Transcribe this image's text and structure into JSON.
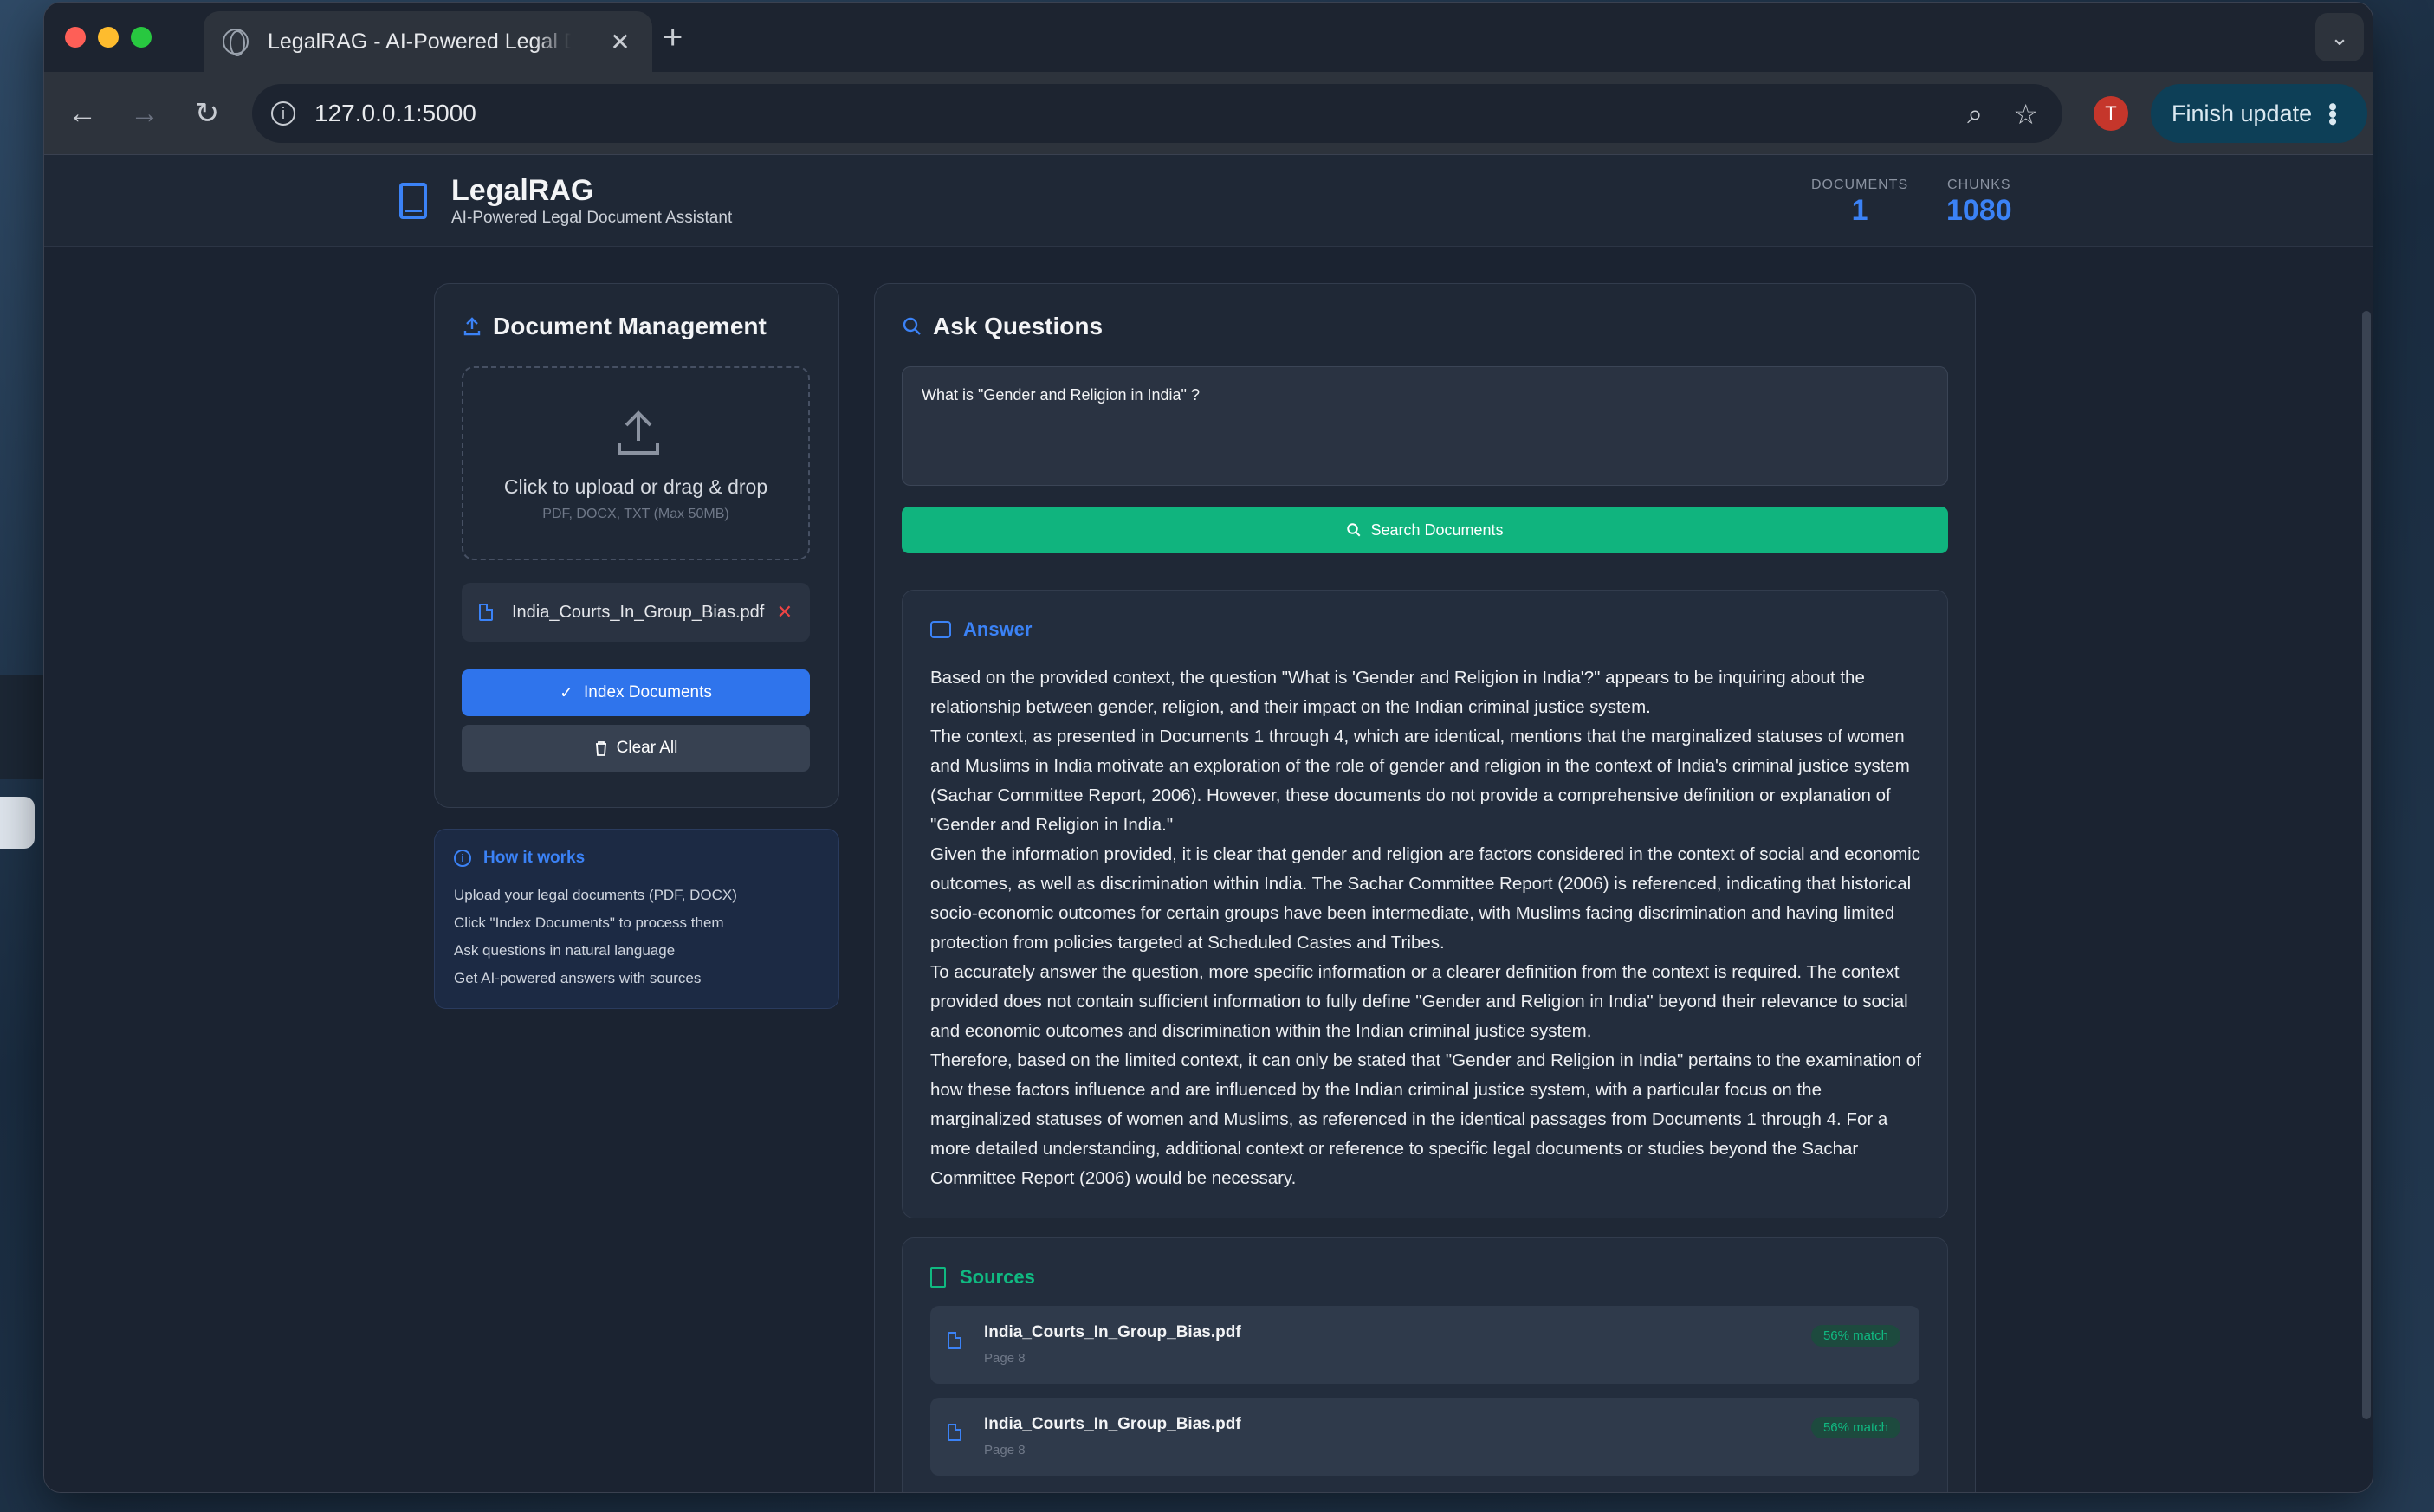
{
  "browser": {
    "tab_title": "LegalRAG - AI-Powered Legal Document Assistant",
    "url": "127.0.0.1:5000",
    "avatar_initial": "T",
    "finish_update": "Finish update"
  },
  "app": {
    "name": "LegalRAG",
    "tagline": "AI-Powered Legal Document Assistant",
    "stats": {
      "documents_label": "DOCUMENTS",
      "documents_value": "1",
      "chunks_label": "CHUNKS",
      "chunks_value": "1080"
    }
  },
  "doc_mgmt": {
    "title": "Document Management",
    "upload_text": "Click to upload or drag & drop",
    "upload_hint": "PDF, DOCX, TXT (Max 50MB)",
    "file_name": "India_Courts_In_Group_Bias.pdf",
    "index_button": "Index Documents",
    "clear_button": "Clear All"
  },
  "how_it_works": {
    "title": "How it works",
    "steps": [
      "Upload your legal documents (PDF, DOCX)",
      "Click \"Index Documents\" to process them",
      "Ask questions in natural language",
      "Get AI-powered answers with sources"
    ]
  },
  "ask": {
    "title": "Ask Questions",
    "question": "What is \"Gender and Religion in India\" ?",
    "search_button": "Search Documents"
  },
  "answer": {
    "title": "Answer",
    "paragraphs": [
      "Based on the provided context, the question \"What is 'Gender and Religion in India'?\" appears to be inquiring about the relationship between gender, religion, and their impact on the Indian criminal justice system.",
      "The context, as presented in Documents 1 through 4, which are identical, mentions that the marginalized statuses of women and Muslims in India motivate an exploration of the role of gender and religion in the context of India's criminal justice system (Sachar Committee Report, 2006). However, these documents do not provide a comprehensive definition or explanation of \"Gender and Religion in India.\"",
      "Given the information provided, it is clear that gender and religion are factors considered in the context of social and economic outcomes, as well as discrimination within India. The Sachar Committee Report (2006) is referenced, indicating that historical socio-economic outcomes for certain groups have been intermediate, with Muslims facing discrimination and having limited protection from policies targeted at Scheduled Castes and Tribes.",
      "To accurately answer the question, more specific information or a clearer definition from the context is required. The context provided does not contain sufficient information to fully define \"Gender and Religion in India\" beyond their relevance to social and economic outcomes and discrimination within the Indian criminal justice system.",
      "Therefore, based on the limited context, it can only be stated that \"Gender and Religion in India\" pertains to the examination of how these factors influence and are influenced by the Indian criminal justice system, with a particular focus on the marginalized statuses of women and Muslims, as referenced in the identical passages from Documents 1 through 4. For a more detailed understanding, additional context or reference to specific legal documents or studies beyond the Sachar Committee Report (2006) would be necessary."
    ]
  },
  "sources": {
    "title": "Sources",
    "items": [
      {
        "file": "India_Courts_In_Group_Bias.pdf",
        "page": "Page 8",
        "match": "56% match"
      },
      {
        "file": "India_Courts_In_Group_Bias.pdf",
        "page": "Page 8",
        "match": "56% match"
      }
    ]
  },
  "colors": {
    "accent_blue": "#3b82f6",
    "accent_green": "#10b981",
    "danger": "#ef4444"
  }
}
